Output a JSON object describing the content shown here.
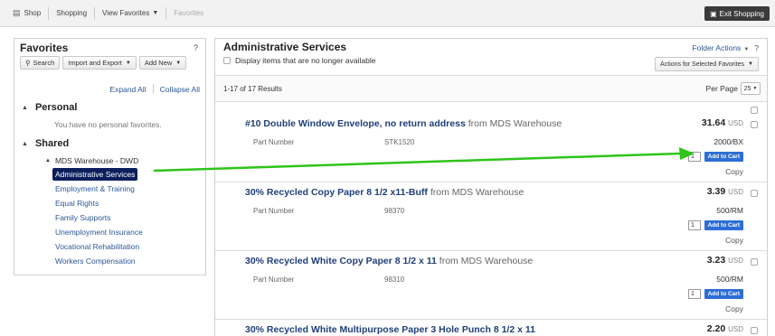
{
  "topbar": {
    "crumbs": [
      "Shop",
      "Shopping",
      "View Favorites",
      "Favorites"
    ],
    "exit_label": "Exit Shopping"
  },
  "favorites_panel": {
    "title": "Favorites",
    "help": "?",
    "search_label": "Search",
    "import_export_label": "Import and Export",
    "add_new_label": "Add New",
    "expand_all": "Expand All",
    "collapse_all": "Collapse All",
    "personal_title": "Personal",
    "personal_empty": "You have no personal favorites.",
    "shared_title": "Shared",
    "shared_root": "MDS Warehouse - DWD",
    "shared_items": [
      "Administrative Services",
      "Employment & Training",
      "Equal Rights",
      "Family Supports",
      "Unemployment Insurance",
      "Vocational Rehabilitation",
      "Workers Compensation"
    ],
    "selected_index": 0
  },
  "main": {
    "title": "Administrative Services",
    "show_unavailable_label": "Display items that are no longer available",
    "folder_actions": "Folder Actions",
    "help": "?",
    "selected_actions": "Actions for Selected Favorites",
    "results": "1-17 of 17 Results",
    "per_page_label": "Per Page",
    "per_page_value": "25",
    "add_to_cart_label": "Add to Cart",
    "copy_label": "Copy",
    "part_number_label": "Part Number",
    "items": [
      {
        "name": "#10 Double Window Envelope, no return address",
        "supplier": "from MDS Warehouse",
        "part_number": "STK1520",
        "price": "31.64",
        "currency": "USD",
        "uom": "2000/BX",
        "qty": "1"
      },
      {
        "name": "30% Recycled Copy Paper 8 1/2 x11-Buff",
        "supplier": "from MDS Warehouse",
        "part_number": "98370",
        "price": "3.39",
        "currency": "USD",
        "uom": "500/RM",
        "qty": "1"
      },
      {
        "name": "30% Recycled White Copy Paper 8 1/2 x 11",
        "supplier": "from MDS Warehouse",
        "part_number": "98310",
        "price": "3.23",
        "currency": "USD",
        "uom": "500/RM",
        "qty": "1"
      },
      {
        "name": "30% Recycled White Multipurpose Paper 3 Hole Punch 8 1/2 x 11",
        "supplier": "",
        "part_number": "",
        "price": "2.20",
        "currency": "USD",
        "uom": "",
        "qty": ""
      }
    ]
  },
  "annotation": {
    "arrow_color": "#2ec41a"
  }
}
